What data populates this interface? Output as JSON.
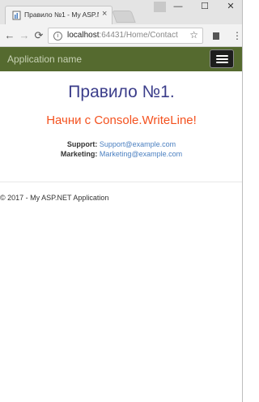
{
  "browser": {
    "tab_title": "Правило №1 - My ASP.N",
    "tab_close": "×",
    "url_host": "localhost",
    "url_rest": ":64431/Home/Contact",
    "win_minimize": "—",
    "win_maximize": "☐",
    "win_close": "✕",
    "back": "←",
    "forward": "→",
    "reload": "⟳",
    "star": "☆",
    "menu": "⋮",
    "info": "i"
  },
  "navbar": {
    "brand": "Application name"
  },
  "content": {
    "title": "Правило №1.",
    "subtitle": "Начни с Console.WriteLine!",
    "support_label": "Support:",
    "support_email": "Support@example.com",
    "marketing_label": "Marketing:",
    "marketing_email": "Marketing@example.com"
  },
  "footer": {
    "text": "© 2017 - My ASP.NET Application"
  },
  "colors": {
    "navbar": "#556a2f",
    "title": "#3b3d8a",
    "subtitle": "#f4511e",
    "link": "#4a7fc0"
  },
  "icons": [
    "page-favicon-icon",
    "info-icon",
    "star-icon",
    "extension-icon",
    "menu-icon",
    "hamburger-icon"
  ]
}
